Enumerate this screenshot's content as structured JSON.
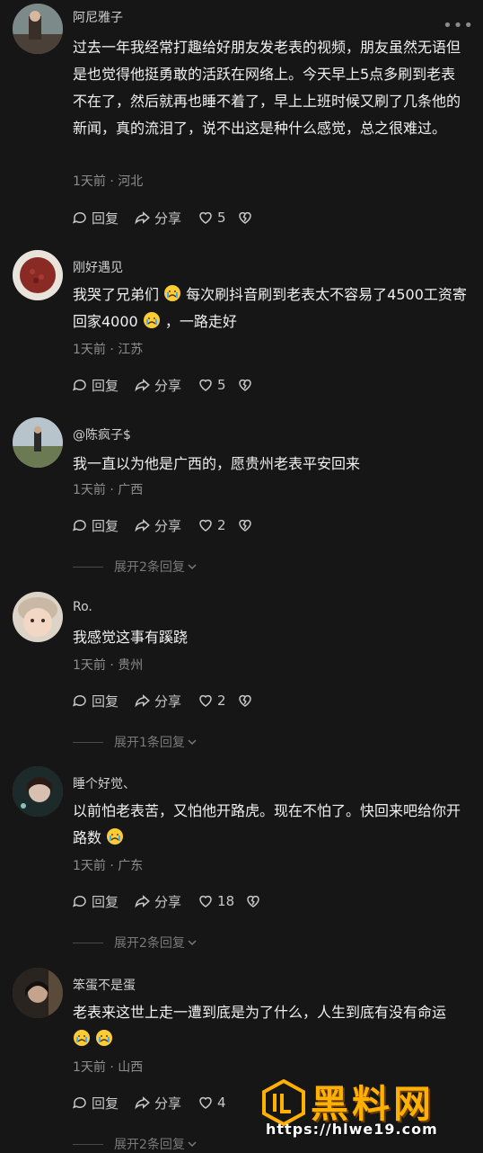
{
  "comments": [
    {
      "username": "阿尼雅子",
      "text": "过去一年我经常打趣给好朋友发老表的视频，朋友虽然无语但是也觉得他挺勇敢的活跃在网络上。今天早上5点多刷到老表不在了，然后就再也睡不着了，早上上班时候又刷了几条他的新闻，真的流泪了，说不出这是种什么感觉，总之很难过。",
      "meta": "1天前 · 河北",
      "reply": "回复",
      "share": "分享",
      "likes": "5"
    },
    {
      "username": "刚好遇见",
      "text_parts": [
        "我哭了兄弟们 ",
        " 每次刷抖音刷到老表太不容易了4500工资寄回家4000 ",
        " ，一路走好"
      ],
      "meta": "1天前 · 江苏",
      "reply": "回复",
      "share": "分享",
      "likes": "5"
    },
    {
      "username": "@陈疯子$",
      "text": "我一直以为他是广西的，愿贵州老表平安回来",
      "meta": "1天前 · 广西",
      "reply": "回复",
      "share": "分享",
      "likes": "2",
      "expand": "展开2条回复"
    },
    {
      "username": "Ro.",
      "text": "我感觉这事有蹊跷",
      "meta": "1天前 · 贵州",
      "reply": "回复",
      "share": "分享",
      "likes": "2",
      "expand": "展开1条回复"
    },
    {
      "username": "睡个好觉、",
      "text_parts": [
        "以前怕老表苦，又怕他开路虎。现在不怕了。快回来吧给你开路数 "
      ],
      "meta": "1天前 · 广东",
      "reply": "回复",
      "share": "分享",
      "likes": "18",
      "expand": "展开2条回复"
    },
    {
      "username": "笨蛋不是蛋",
      "text_parts": [
        "老表来这世上走一遭到底是为了什么，人生到底有没有命运 ",
        " ",
        ""
      ],
      "meta": "1天前 · 山西",
      "reply": "回复",
      "share": "分享",
      "likes": "4",
      "expand": "展开2条回复"
    }
  ],
  "watermark": {
    "title": "黑料网",
    "url": "https://hlwe19.com"
  },
  "colors": {
    "background": "#161616",
    "text": "#f0f0f0",
    "meta": "#8e8e8e",
    "watermark": "#ffb000"
  }
}
